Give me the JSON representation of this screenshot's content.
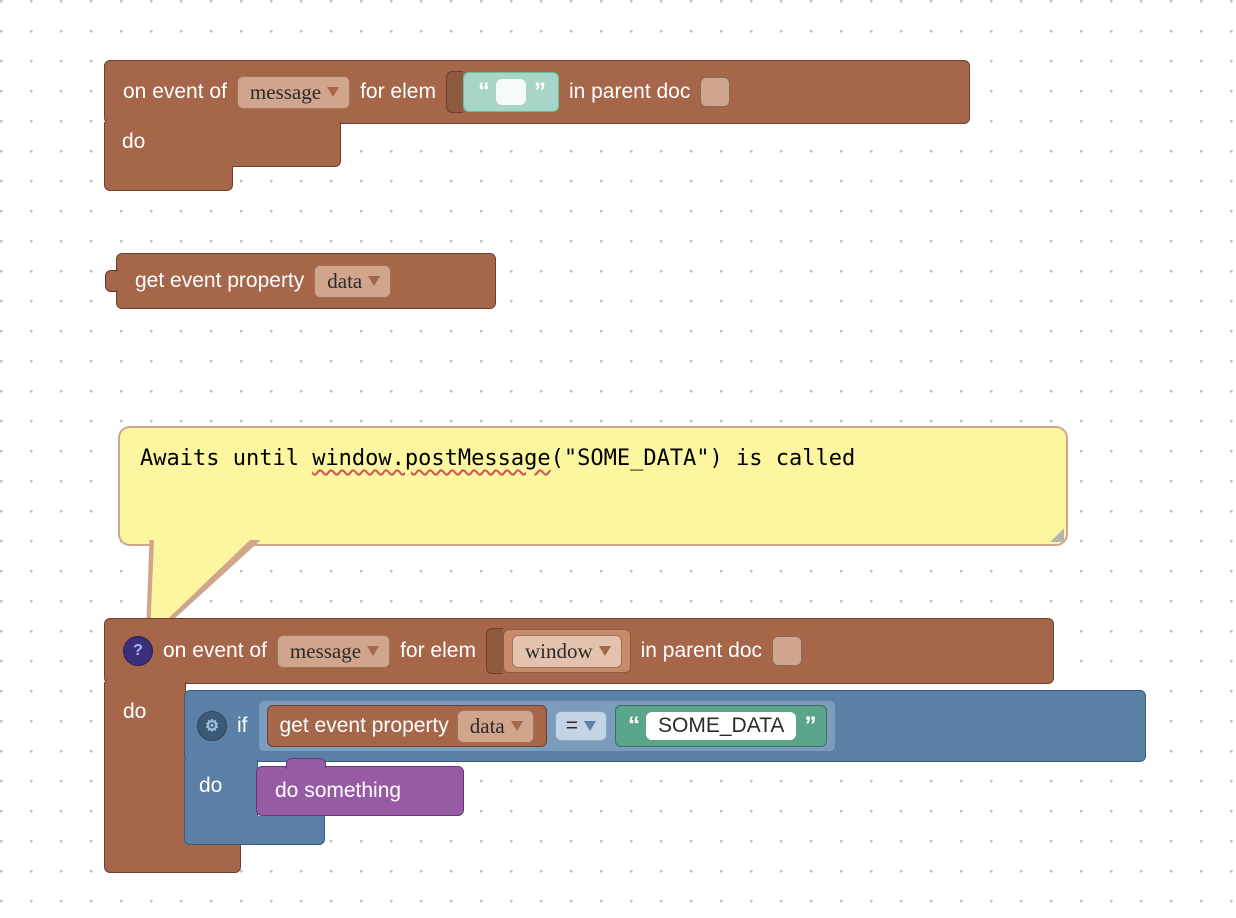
{
  "block1": {
    "on_event_of": "on event of",
    "event_dropdown": "message",
    "for_elem": "for elem",
    "string_value": "",
    "in_parent_doc": "in parent doc",
    "do_label": "do"
  },
  "block2": {
    "get_event_property": "get event property",
    "prop_dropdown": "data"
  },
  "comment": {
    "text_pre": "Awaits until ",
    "text_wavy": "window.postMessage",
    "text_post": "(\"SOME_DATA\") is called"
  },
  "block3": {
    "on_event_of": "on event of",
    "event_dropdown": "message",
    "for_elem": "for elem",
    "elem_dropdown": "window",
    "in_parent_doc": "in parent doc",
    "do_label": "do",
    "if_label": "if",
    "inner_get": "get event property",
    "inner_prop": "data",
    "compare": "=",
    "string_literal": "SOME_DATA",
    "inner_do": "do",
    "do_something": "do something"
  }
}
